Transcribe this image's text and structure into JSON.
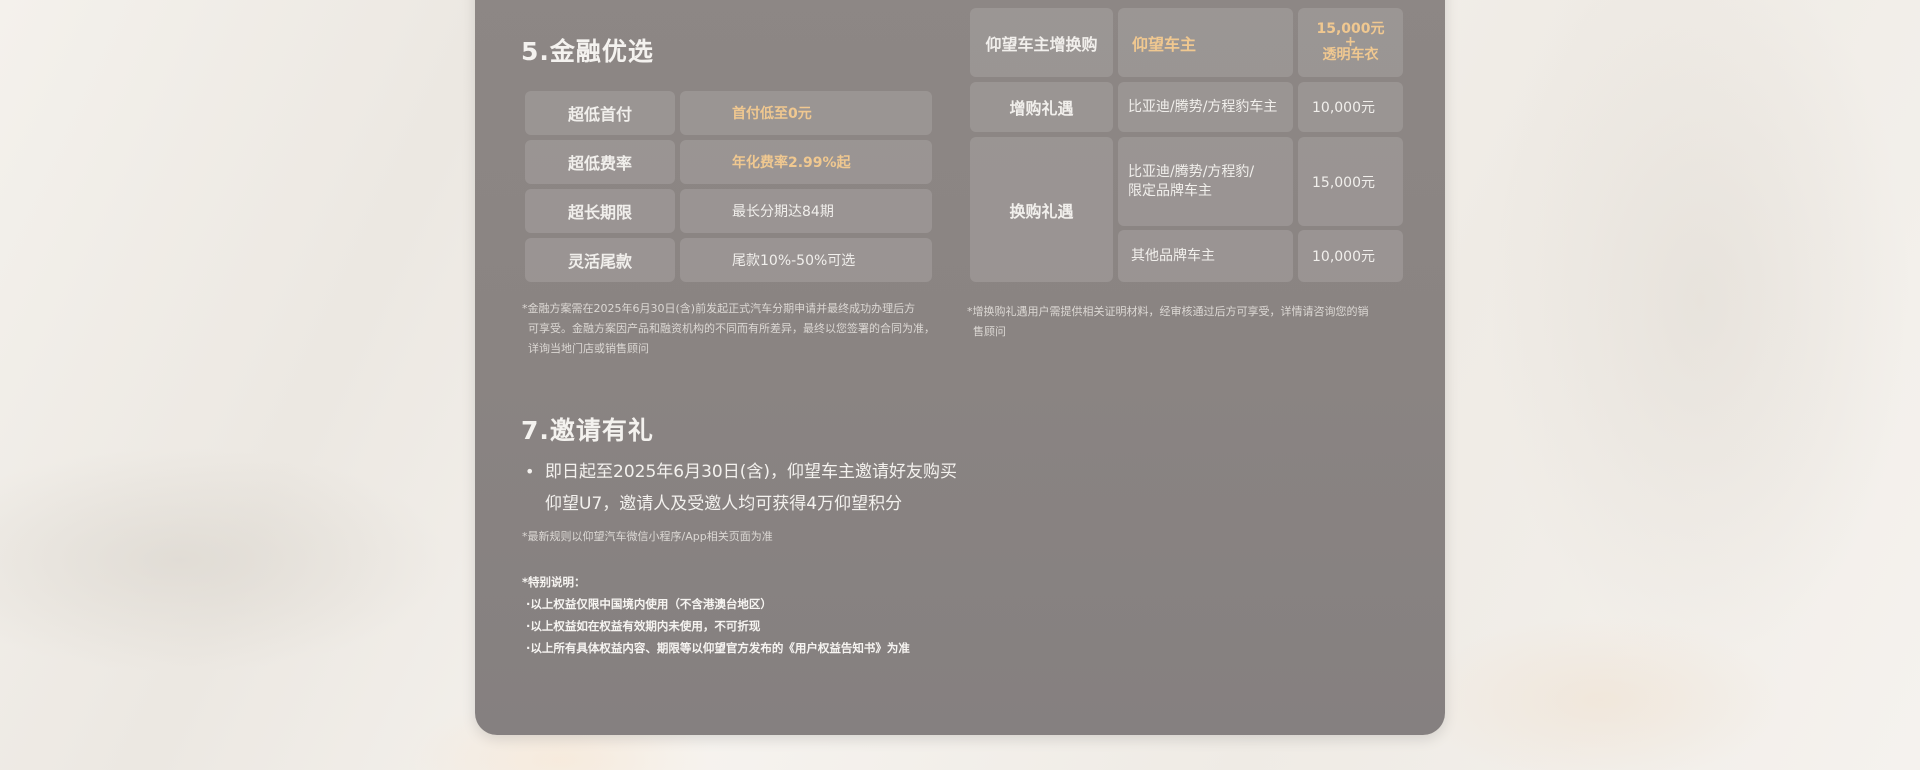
{
  "finance": {
    "title": "5.金融优选",
    "rows": [
      {
        "label": "超低首付",
        "value": "首付低至0元",
        "highlight": true
      },
      {
        "label": "超低费率",
        "value": "年化费率2.99%起",
        "highlight": true
      },
      {
        "label": "超长期限",
        "value": "最长分期达84期",
        "highlight": false
      },
      {
        "label": "灵活尾款",
        "value": "尾款10%-50%可选",
        "highlight": false
      }
    ],
    "note_lines": [
      "*金融方案需在2025年6月30日(含)前发起正式汽车分期申请并最终成功办理后方",
      "可享受。金融方案因产品和融资机构的不同而有所差异，最终以您签署的合同为准，",
      "详询当地门店或销售顾问"
    ]
  },
  "trade": {
    "owner_row": {
      "label": "仰望车主增换购",
      "target": "仰望车主",
      "reward_line1": "15,000元",
      "reward_plus": "+",
      "reward_line2": "透明车衣"
    },
    "add_row": {
      "label": "增购礼遇",
      "target": "比亚迪/腾势/方程豹车主",
      "reward": "10,000元"
    },
    "swap_label": "换购礼遇",
    "swap_rows": [
      {
        "target_line1": "比亚迪/腾势/方程豹/",
        "target_line2": "限定品牌车主",
        "reward": "15,000元"
      },
      {
        "target_line1": "其他品牌车主",
        "target_line2": "",
        "reward": "10,000元"
      }
    ],
    "note_lines": [
      "*增换购礼遇用户需提供相关证明材料，经审核通过后方可享受，详情请咨询您的销",
      "售顾问"
    ]
  },
  "invite": {
    "title": "7.邀请有礼",
    "bullet_line1": "即日起至2025年6月30日(含)，仰望车主邀请好友购买",
    "bullet_line2": "仰望U7，邀请人及受邀人均可获得4万仰望积分",
    "note": "*最新规则以仰望汽车微信小程序/App相关页面为准"
  },
  "special": {
    "title": "*特别说明：",
    "items": [
      "·以上权益仅限中国境内使用（不含港澳台地区）",
      "·以上权益如在权益有效期内未使用，不可折现",
      "·以上所有具体权益内容、期限等以仰望官方发布的《用户权益告知书》为准"
    ]
  },
  "colors": {
    "gold": "#f0c890",
    "card": "#8a8482",
    "text": "#f1efec"
  }
}
